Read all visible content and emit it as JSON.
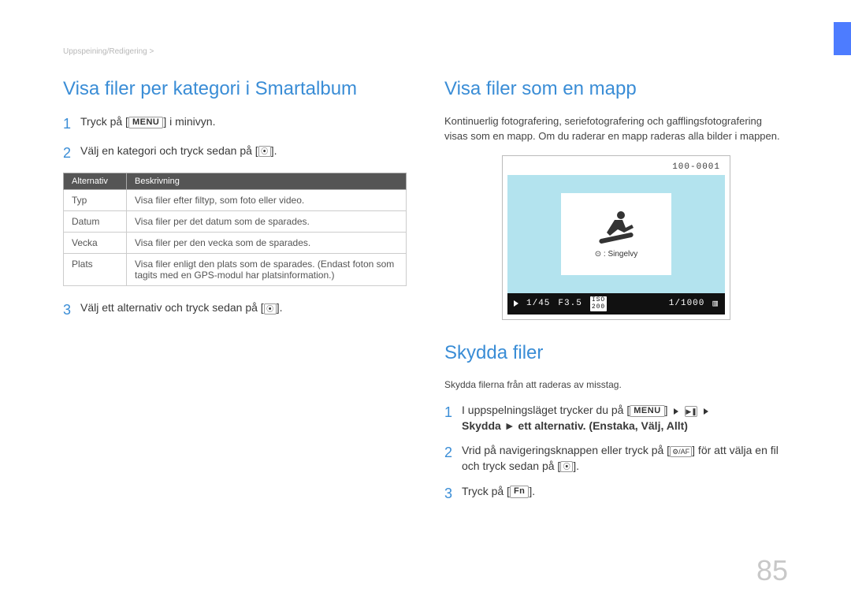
{
  "breadcrumb": "Uppspeining/Redigering >",
  "left": {
    "heading": "Visa filer per kategori i Smartalbum",
    "step1_pre": "Tryck på [",
    "step1_btn": "MENU",
    "step1_post": "] i minivyn.",
    "step2": "Välj en kategori och tryck sedan på [",
    "step2_icon": "⦿",
    "step2_post": "].",
    "table": {
      "h1": "Alternativ",
      "h2": "Beskrivning",
      "rows": [
        {
          "a": "Typ",
          "b": "Visa filer efter filtyp, som foto eller video."
        },
        {
          "a": "Datum",
          "b": "Visa filer per det datum som de sparades."
        },
        {
          "a": "Vecka",
          "b": "Visa filer per den vecka som de sparades."
        },
        {
          "a": "Plats",
          "b": "Visa filer enligt den plats som de sparades. (Endast foton som tagits med en GPS-modul har platsinformation.)"
        }
      ]
    },
    "step3": "Välj ett alternativ och tryck sedan på [",
    "step3_icon": "⦿",
    "step3_post": "]."
  },
  "right": {
    "heading1": "Visa filer som en mapp",
    "para1": "Kontinuerlig fotografering, seriefotografering och gafflingsfotografering visas som en mapp. Om du raderar en mapp raderas alla bilder i mappen.",
    "camera": {
      "file_id": "100-0001",
      "caption_icon": "⊙",
      "caption": ": Singelvy",
      "bar_count": "1/45",
      "bar_f": "F3.5",
      "bar_iso_label": "ISO",
      "bar_iso": "200",
      "bar_shutter": "1/1000"
    },
    "heading2": "Skydda filer",
    "para2": "Skydda filerna från att raderas av misstag.",
    "p_step1_a": "I uppspelningsläget trycker du på [",
    "p_step1_menu": "MENU",
    "p_step1_b": "] ",
    "p_step1_icon": "▶❚",
    "p_step1_line2": "Skydda ► ett alternativ. (Enstaka, Välj, Allt)",
    "p_step2_a": "Vrid på navigeringsknappen eller tryck på [",
    "p_step2_icon": "⚙/AF",
    "p_step2_b": "] för att välja en fil och tryck sedan på [",
    "p_step2_icon2": "⦿",
    "p_step2_c": "].",
    "p_step3_a": "Tryck på [",
    "p_step3_btn": "Fn",
    "p_step3_b": "]."
  },
  "page_number": "85"
}
